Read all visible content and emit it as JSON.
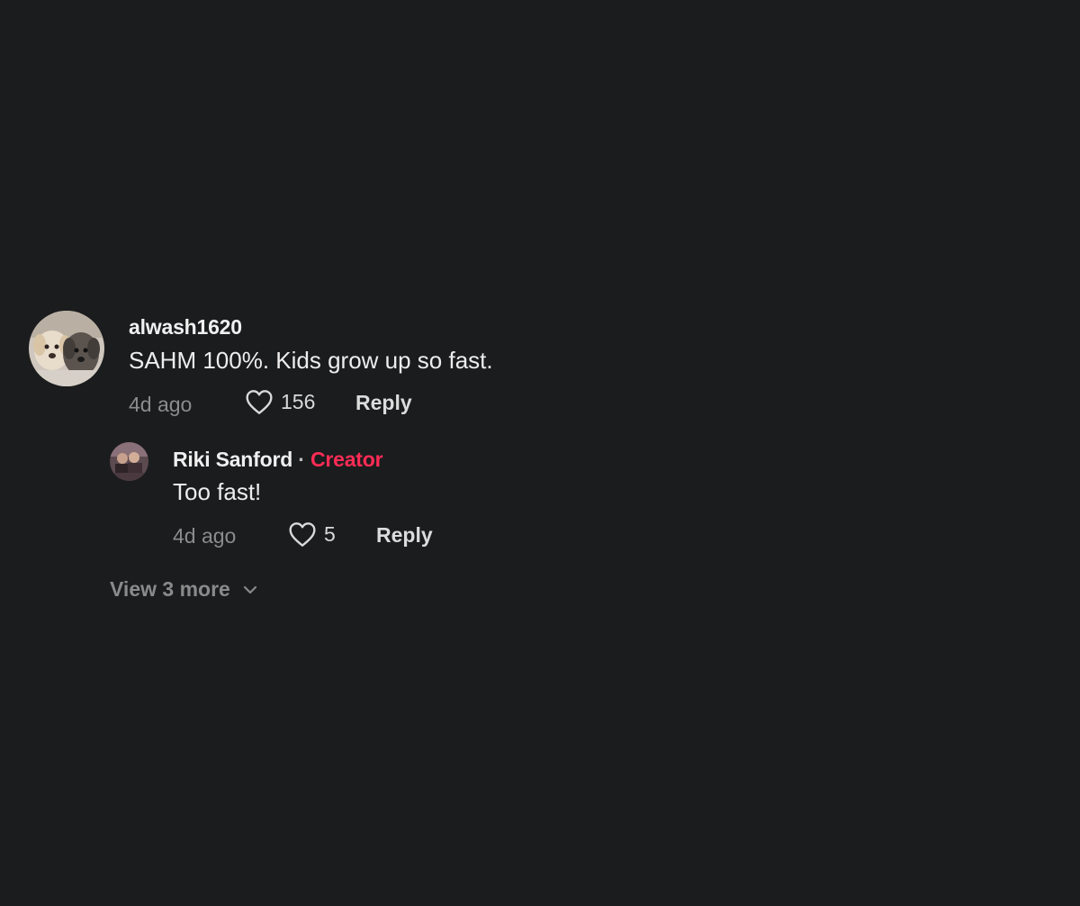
{
  "comment": {
    "username": "alwash1620",
    "text": "SAHM 100%. Kids grow up so fast.",
    "time": "4d ago",
    "likes": "156",
    "reply_label": "Reply",
    "avatar_icon": "dogs-avatar-photo"
  },
  "reply": {
    "username": "Riki Sanford",
    "separator": "·",
    "badge": "Creator",
    "text": "Too fast!",
    "time": "4d ago",
    "likes": "5",
    "reply_label": "Reply",
    "avatar_icon": "user-avatar-photo"
  },
  "view_more": {
    "label": "View 3 more",
    "icon": "chevron-down-icon"
  },
  "colors": {
    "background": "#1b1c1e",
    "creator_badge": "#fe2c55",
    "muted_text": "#8c8c8c"
  }
}
